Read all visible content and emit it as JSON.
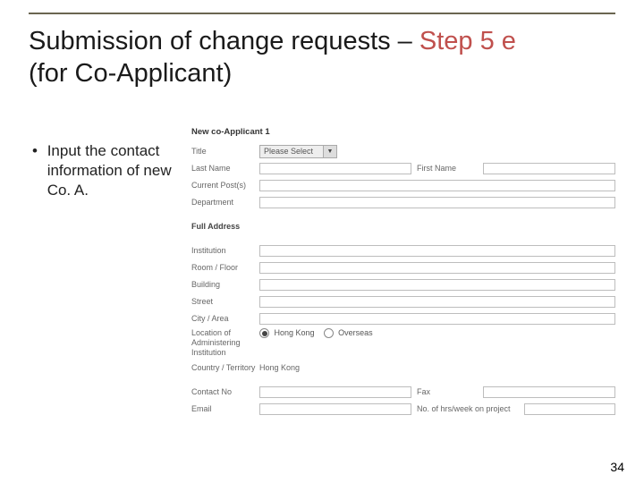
{
  "title_main": "Submission of change requests – ",
  "title_step": "Step 5 e",
  "title_sub": "(for Co-Applicant)",
  "bullet": "Input the contact information of new Co. A.",
  "page_number": "34",
  "form": {
    "section_header": "New co-Applicant 1",
    "title_label": "Title",
    "title_select": "Please Select",
    "last_name": "Last Name",
    "first_name": "First Name",
    "current_post": "Current Post(s)",
    "department": "Department",
    "full_address": "Full Address",
    "institution": "Institution",
    "room_floor": "Room / Floor",
    "building": "Building",
    "street": "Street",
    "city_area": "City / Area",
    "location_label": "Location of Administering Institution",
    "radio_hk": "Hong Kong",
    "radio_overseas": "Overseas",
    "country_label": "Country / Territory",
    "country_value": "Hong Kong",
    "contact_no": "Contact No",
    "fax": "Fax",
    "email": "Email",
    "hrs_week": "No. of hrs/week on project"
  }
}
